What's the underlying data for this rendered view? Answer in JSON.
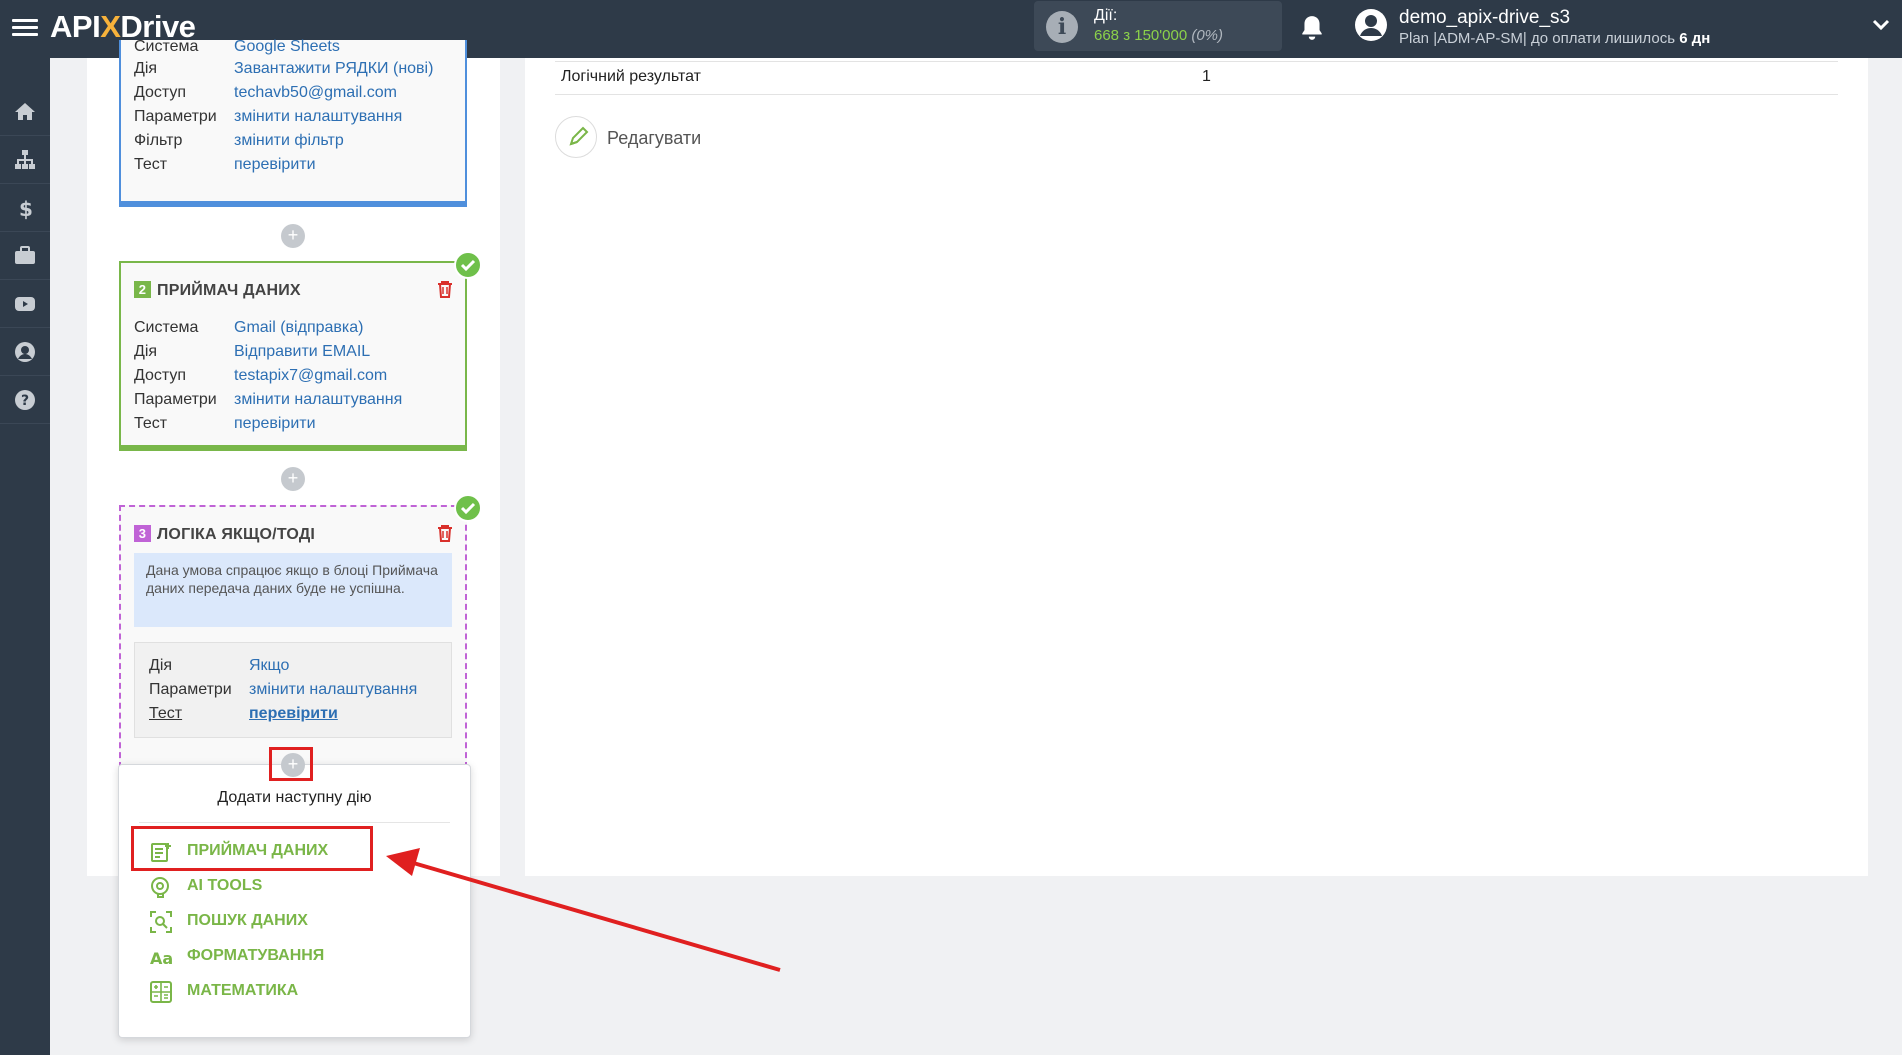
{
  "header": {
    "logo_api": "API",
    "logo_x": "X",
    "logo_drive": "Drive",
    "actions_label": "Дії:",
    "actions_count": "668 з 150'000",
    "actions_pct": "(0%)",
    "username": "demo_apix-drive_s3",
    "plan_text": "Plan |ADM-AP-SM| до оплати лишилось ",
    "plan_days": "6 дн"
  },
  "sidebar": {
    "items": [
      {
        "icon": "home-icon"
      },
      {
        "icon": "sitemap-icon"
      },
      {
        "icon": "dollar-icon"
      },
      {
        "icon": "briefcase-icon"
      },
      {
        "icon": "youtube-icon"
      },
      {
        "icon": "user-icon"
      },
      {
        "icon": "help-icon"
      }
    ]
  },
  "block1": {
    "rows": [
      {
        "key": "Система",
        "value": "Google Sheets"
      },
      {
        "key": "Дія",
        "value": "Завантажити РЯДКИ (нові)"
      },
      {
        "key": "Доступ",
        "value": "techavb50@gmail.com"
      },
      {
        "key": "Параметри",
        "value": "змінити налаштування"
      },
      {
        "key": "Фільтр",
        "value": "змінити фільтр"
      },
      {
        "key": "Тест",
        "value": "перевірити"
      }
    ],
    "color": "#4f8fdc"
  },
  "block2": {
    "number": "2",
    "title": "ПРИЙМАЧ ДАНИХ",
    "color": "#79b74a",
    "rows": [
      {
        "key": "Система",
        "value": "Gmail (відправка)"
      },
      {
        "key": "Дія",
        "value": "Відправити EMAIL"
      },
      {
        "key": "Доступ",
        "value": "testapix7@gmail.com"
      },
      {
        "key": "Параметри",
        "value": "змінити налаштування"
      },
      {
        "key": "Тест",
        "value": "перевірити"
      }
    ]
  },
  "block3": {
    "number": "3",
    "title": "ЛОГІКА ЯКЩО/ТОДІ",
    "color": "#c063d6",
    "note": "Дана умова спрацює якщо в блоці Приймача даних передача даних буде не успішна.",
    "rows": [
      {
        "key": "Дія",
        "value": "Якщо"
      },
      {
        "key": "Параметри",
        "value": "змінити налаштування"
      },
      {
        "key": "Тест",
        "value": "перевірити"
      }
    ]
  },
  "dropdown": {
    "title": "Додати наступну дію",
    "items": [
      {
        "label": "ПРИЙМАЧ ДАНИХ",
        "icon": "data-receiver-icon"
      },
      {
        "label": "AI TOOLS",
        "icon": "ai-tools-icon"
      },
      {
        "label": "ПОШУК ДАНИХ",
        "icon": "data-search-icon"
      },
      {
        "label": "ФОРМАТУВАННЯ",
        "icon": "formatting-icon"
      },
      {
        "label": "МАТЕМАТИКА",
        "icon": "math-icon"
      }
    ],
    "accent": "#7ab648"
  },
  "result": {
    "label": "Логічний результат",
    "value": "1",
    "edit_label": "Редагувати"
  }
}
